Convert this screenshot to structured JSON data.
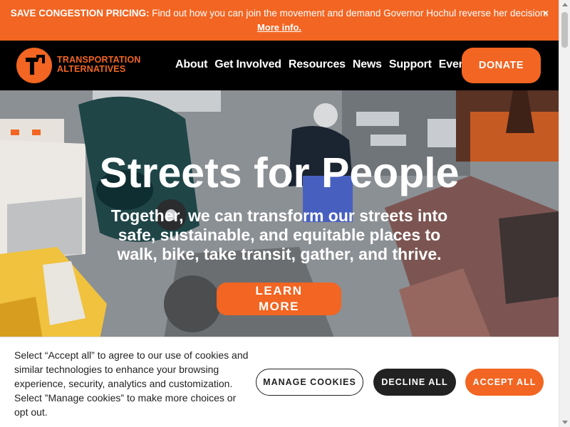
{
  "alert": {
    "strong": "SAVE CONGESTION PRICING:",
    "message": " Find out how you can join the movement and demand Governor Hochul reverse her decision.",
    "more_link": "More info.",
    "close": "×"
  },
  "header": {
    "logo_line1": "TRANSPORTATION",
    "logo_line2": "ALTERNATIVES",
    "nav": [
      "About",
      "Get Involved",
      "Resources",
      "News",
      "Support",
      "Events"
    ],
    "donate": "DONATE"
  },
  "hero": {
    "title": "Streets for People",
    "subtitle": "Together, we can transform our streets into safe, sustainable, and equitable places to walk, bike, take transit, gather, and thrive.",
    "button_line1": "LEARN",
    "button_line2": "MORE"
  },
  "cookie": {
    "text": "Select “Accept all” to agree to our use of cookies and similar technologies to enhance your browsing experience, security, analytics and customization. Select ”Manage cookies” to make more choices or opt out.",
    "manage": "MANAGE COOKIES",
    "decline": "DECLINE ALL",
    "accept": "ACCEPT ALL"
  },
  "colors": {
    "brand_orange": "#f26522",
    "header_bg": "#000000",
    "dark_button": "#222222"
  },
  "icons": {
    "close": "close-icon",
    "logo": "ta-logo-icon"
  }
}
